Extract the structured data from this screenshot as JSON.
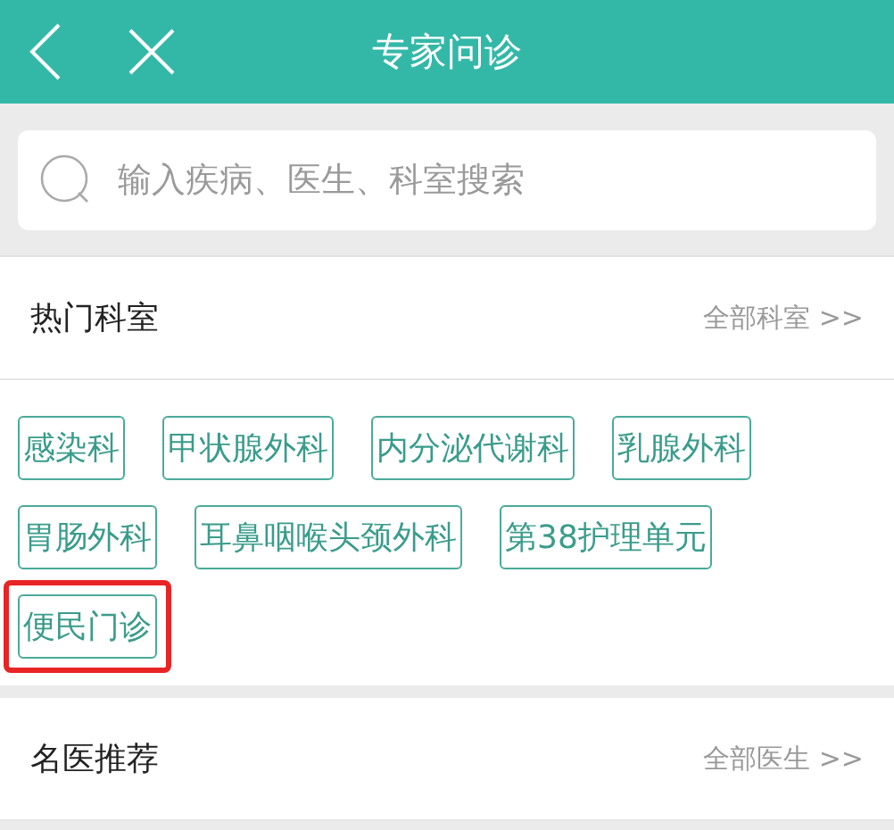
{
  "header": {
    "title": "专家问诊"
  },
  "search": {
    "placeholder": "输入疾病、医生、科室搜索"
  },
  "departments": {
    "title": "热门科室",
    "more_link": "全部科室 >>",
    "tags": [
      {
        "label": "感染科",
        "highlighted": false
      },
      {
        "label": "甲状腺外科",
        "highlighted": false
      },
      {
        "label": "内分泌代谢科",
        "highlighted": false
      },
      {
        "label": "乳腺外科",
        "highlighted": false
      },
      {
        "label": "胃肠外科",
        "highlighted": false
      },
      {
        "label": "耳鼻咽喉头颈外科",
        "highlighted": false
      },
      {
        "label": "第38护理单元",
        "highlighted": false
      },
      {
        "label": "便民门诊",
        "highlighted": true
      }
    ]
  },
  "doctors": {
    "title": "名医推荐",
    "more_link": "全部医生 >>"
  }
}
